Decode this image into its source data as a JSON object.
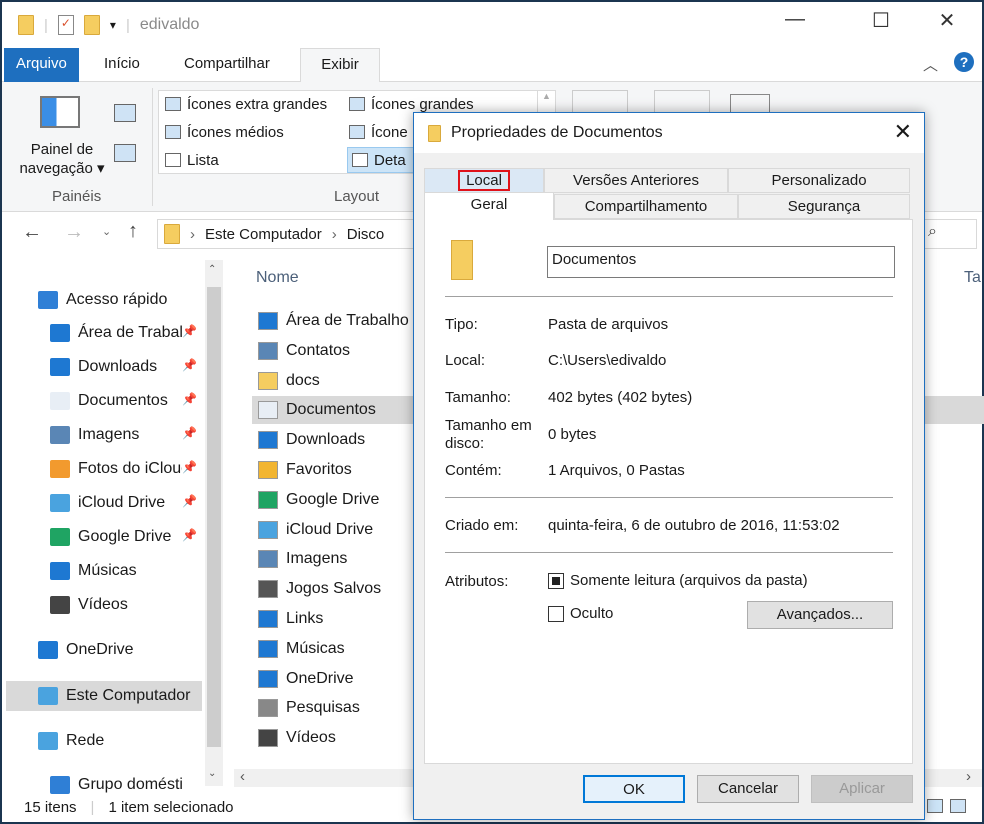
{
  "window": {
    "title": "edivaldo",
    "controls": {
      "minimize": "—",
      "maximize": "☐",
      "close": "✕"
    }
  },
  "ribbon": {
    "tabs": [
      "Arquivo",
      "Início",
      "Compartilhar",
      "Exibir"
    ],
    "active_tab": "Exibir",
    "paineis": {
      "nav_pane": "Painel de navegação ▾",
      "group": "Painéis"
    },
    "layout": {
      "items": [
        "Ícones extra grandes",
        "Ícones grandes",
        "Ícones médios",
        "Ícones pequenos",
        "Lista",
        "Detalhes"
      ],
      "visible": [
        "Ícones extra grandes",
        "Ícones grandes",
        "Ícones médios",
        "Ícone",
        "Lista",
        "Deta"
      ],
      "group": "Layout"
    }
  },
  "address": {
    "path": [
      "Este Computador",
      "Disco"
    ]
  },
  "nav": [
    {
      "label": "Acesso rápido",
      "icon": "star-icon"
    },
    {
      "label": "Área de Trabalho",
      "icon": "desktop-icon",
      "pinned": true
    },
    {
      "label": "Downloads",
      "icon": "download-icon",
      "pinned": true
    },
    {
      "label": "Documentos",
      "icon": "document-icon",
      "pinned": true
    },
    {
      "label": "Imagens",
      "icon": "image-icon",
      "pinned": true
    },
    {
      "label": "Fotos do iCloud",
      "icon": "photos-icon",
      "pinned": true
    },
    {
      "label": "iCloud Drive",
      "icon": "icloud-icon",
      "pinned": true
    },
    {
      "label": "Google Drive",
      "icon": "google-drive-icon",
      "pinned": true
    },
    {
      "label": "Músicas",
      "icon": "music-icon"
    },
    {
      "label": "Vídeos",
      "icon": "video-icon"
    },
    {
      "label": "OneDrive",
      "icon": "onedrive-icon"
    },
    {
      "label": "Este Computador",
      "icon": "computer-icon",
      "selected": true
    },
    {
      "label": "Rede",
      "icon": "network-icon"
    },
    {
      "label": "Grupo doméstico",
      "icon": "homegroup-icon"
    }
  ],
  "files": {
    "column_name": "Nome",
    "column_t": "Ta",
    "items": [
      "Área de Trabalho",
      "Contatos",
      "docs",
      "Documentos",
      "Downloads",
      "Favoritos",
      "Google Drive",
      "iCloud Drive",
      "Imagens",
      "Jogos Salvos",
      "Links",
      "Músicas",
      "OneDrive",
      "Pesquisas",
      "Vídeos"
    ],
    "selected": "Documentos"
  },
  "status": {
    "count": "15 itens",
    "selected": "1 item selecionado"
  },
  "dialog": {
    "title": "Propriedades de Documentos",
    "tabs_row1": [
      "Local",
      "Versões Anteriores",
      "Personalizado"
    ],
    "tabs_row2": [
      "Geral",
      "Compartilhamento",
      "Segurança"
    ],
    "active_tab": "Geral",
    "highlighted_tab": "Local",
    "name": "Documentos",
    "fields": {
      "tipo": {
        "label": "Tipo:",
        "value": "Pasta de arquivos"
      },
      "local": {
        "label": "Local:",
        "value": "C:\\Users\\edivaldo"
      },
      "tamanho": {
        "label": "Tamanho:",
        "value": "402 bytes (402 bytes)"
      },
      "disco": {
        "label": "Tamanho em disco:",
        "value": "0 bytes"
      },
      "contem": {
        "label": "Contém:",
        "value": "1 Arquivos, 0 Pastas"
      },
      "criado": {
        "label": "Criado em:",
        "value": "quinta-feira, 6 de outubro de 2016, 11:53:02"
      }
    },
    "atributos": {
      "label": "Atributos:",
      "readonly": "Somente leitura (arquivos da pasta)",
      "readonly_checked": true,
      "hidden": "Oculto",
      "hidden_checked": false,
      "advanced": "Avançados..."
    },
    "buttons": {
      "ok": "OK",
      "cancel": "Cancelar",
      "apply": "Aplicar"
    }
  }
}
